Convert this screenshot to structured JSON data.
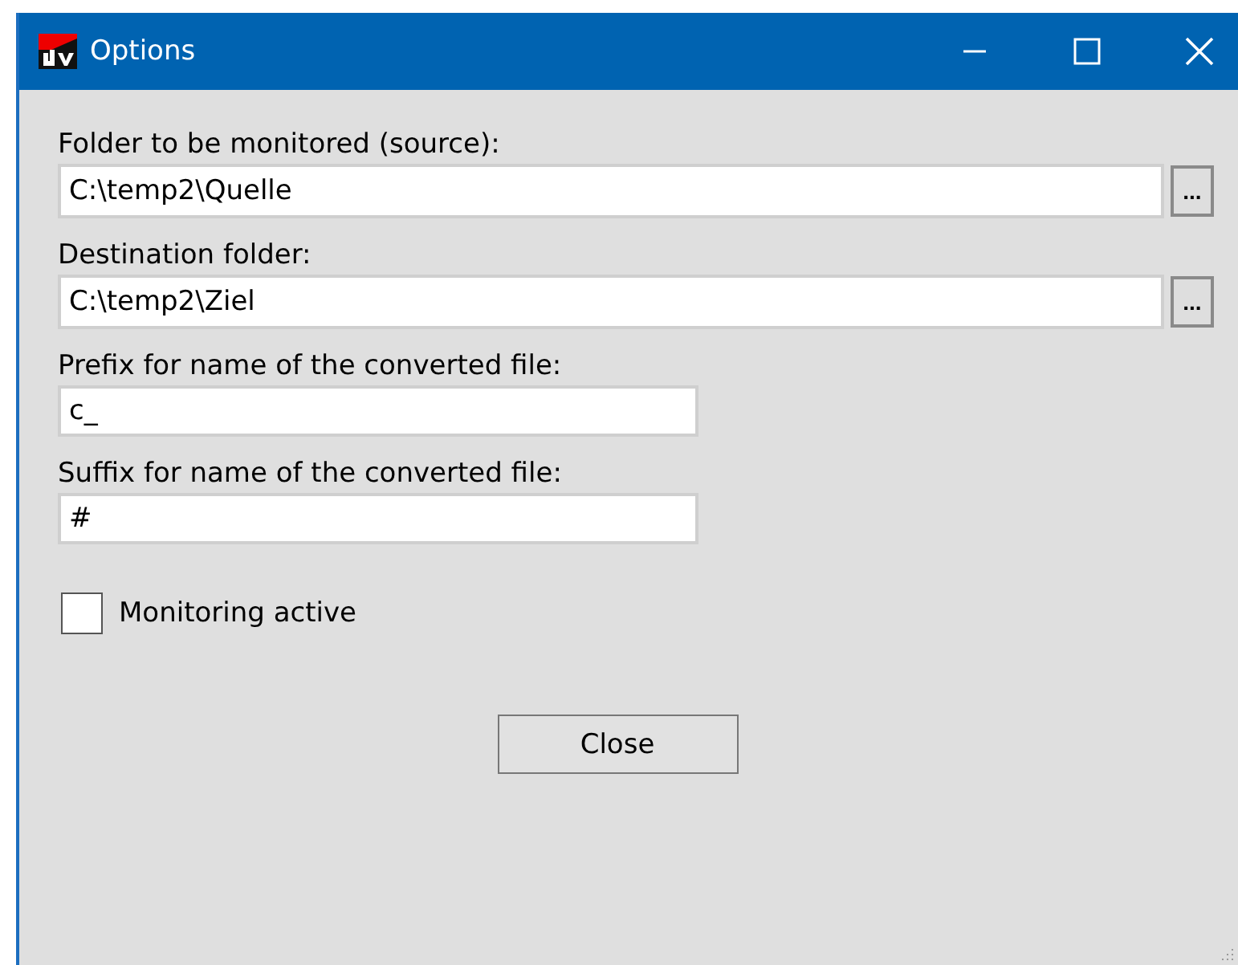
{
  "window": {
    "title": "Options"
  },
  "fields": [
    {
      "kind": "path",
      "label": "Folder to be monitored (source):",
      "value": "C:\\temp2\\Quelle",
      "browse": "..."
    },
    {
      "kind": "path",
      "label": "Destination folder:",
      "value": "C:\\temp2\\Ziel",
      "browse": "..."
    },
    {
      "kind": "text",
      "label": "Prefix for name of the converted file:",
      "value": "c_"
    },
    {
      "kind": "text",
      "label": "Suffix for name of the converted file:",
      "value": "#"
    }
  ],
  "monitoring": {
    "label": "Monitoring active",
    "checked": false
  },
  "buttons": [
    "Close"
  ]
}
